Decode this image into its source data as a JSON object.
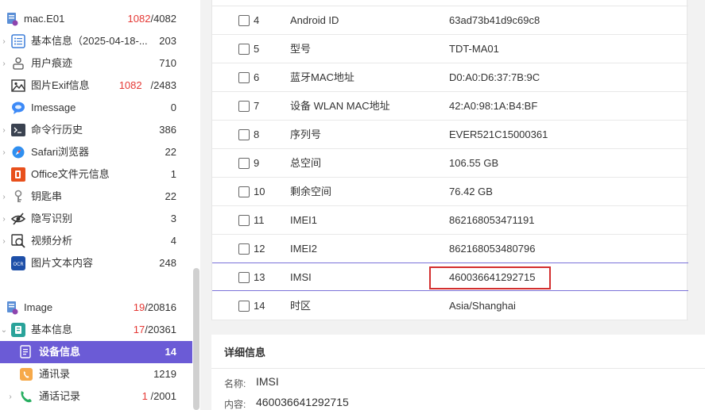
{
  "sidebar": {
    "items": [
      {
        "label": "mac.E01",
        "count_red": "1082",
        "count_rest": "/4082",
        "icon": "device-file-icon"
      },
      {
        "label": "基本信息（2025-04-18-...",
        "count_red": "",
        "count_rest": "203",
        "icon": "list-icon"
      },
      {
        "label": "用户痕迹",
        "count_red": "",
        "count_rest": "710",
        "icon": "user-trace-icon"
      },
      {
        "label": "图片Exif信息",
        "count_red": "1082",
        "count_rest": "/2483",
        "icon": "image-icon"
      },
      {
        "label": "Imessage",
        "count_red": "",
        "count_rest": "0",
        "icon": "message-bubble-icon"
      },
      {
        "label": "命令行历史",
        "count_red": "",
        "count_rest": "386",
        "icon": "terminal-icon"
      },
      {
        "label": "Safari浏览器",
        "count_red": "",
        "count_rest": "22",
        "icon": "safari-compass-icon"
      },
      {
        "label": "Office文件元信息",
        "count_red": "",
        "count_rest": "1",
        "icon": "office-icon"
      },
      {
        "label": "钥匙串",
        "count_red": "",
        "count_rest": "22",
        "icon": "keychain-icon"
      },
      {
        "label": "隐写识别",
        "count_red": "",
        "count_rest": "3",
        "icon": "hidden-eye-icon"
      },
      {
        "label": "视频分析",
        "count_red": "",
        "count_rest": "4",
        "icon": "video-search-icon"
      },
      {
        "label": "图片文本内容",
        "count_red": "",
        "count_rest": "248",
        "icon": "ocr-icon"
      },
      {
        "label": "Image",
        "count_red": "19",
        "count_rest": "/20816",
        "icon": "device-file-icon"
      },
      {
        "label": "基本信息",
        "count_red": "17",
        "count_rest": "/20361",
        "icon": "basic-info-icon"
      },
      {
        "label": "设备信息",
        "count_red": "",
        "count_rest": "14",
        "icon": "device-info-icon"
      },
      {
        "label": "通讯录",
        "count_red": "",
        "count_rest": "1219",
        "icon": "contacts-icon"
      },
      {
        "label": "通话记录",
        "count_red": "1",
        "count_rest": " /2001",
        "icon": "phone-icon"
      }
    ]
  },
  "table": {
    "rows": [
      {
        "idx": "4",
        "name": "Android ID",
        "value": "63ad73b41d9c69c8"
      },
      {
        "idx": "5",
        "name": "型号",
        "value": "TDT-MA01"
      },
      {
        "idx": "6",
        "name": "蓝牙MAC地址",
        "value": "D0:A0:D6:37:7B:9C"
      },
      {
        "idx": "7",
        "name": "设备 WLAN MAC地址",
        "value": "42:A0:98:1A:B4:BF"
      },
      {
        "idx": "8",
        "name": "序列号",
        "value": "EVER521C15000361"
      },
      {
        "idx": "9",
        "name": "总空间",
        "value": "106.55 GB"
      },
      {
        "idx": "10",
        "name": "剩余空间",
        "value": "76.42 GB"
      },
      {
        "idx": "11",
        "name": "IMEI1",
        "value": "862168053471191"
      },
      {
        "idx": "12",
        "name": "IMEI2",
        "value": "862168053480796"
      },
      {
        "idx": "13",
        "name": "IMSI",
        "value": "460036641292715"
      },
      {
        "idx": "14",
        "name": "时区",
        "value": "Asia/Shanghai"
      }
    ]
  },
  "detail": {
    "title": "详细信息",
    "name_label": "名称:",
    "name_value": "IMSI",
    "content_label": "内容:",
    "content_value": "460036641292715"
  },
  "icons": {
    "ocr_text": "OCR"
  },
  "colors": {
    "accent": "#6b5bd6",
    "highlight_box": "#d32f2f",
    "count_red": "#e53935"
  }
}
